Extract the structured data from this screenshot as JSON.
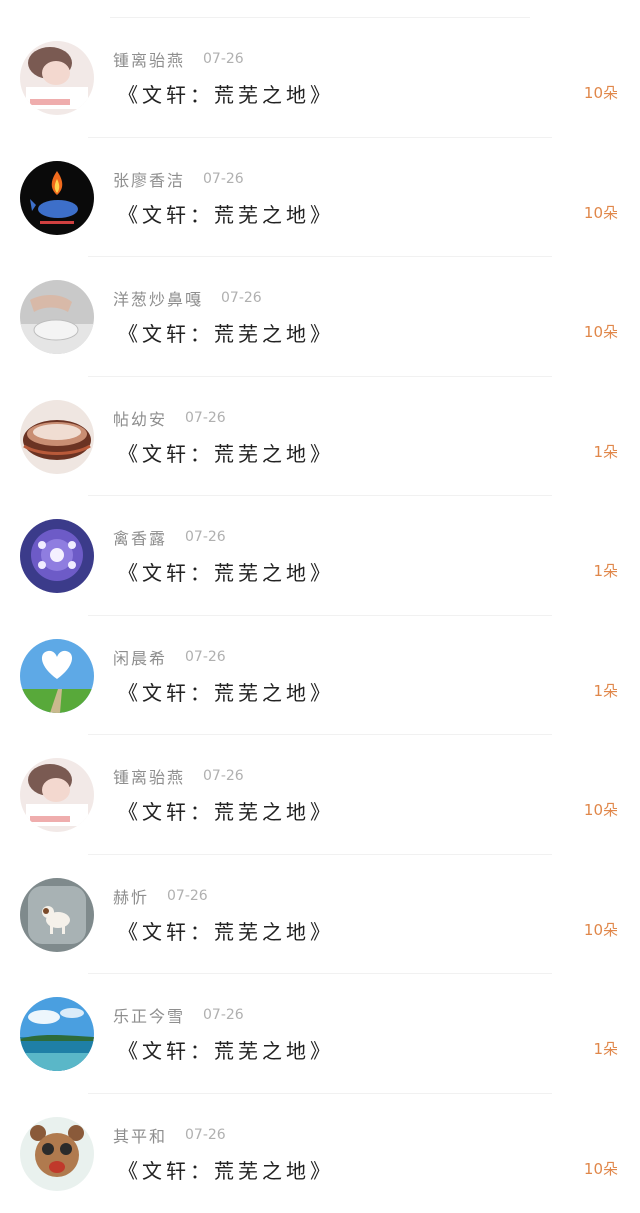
{
  "colors": {
    "accent": "#e0874a",
    "name_text": "#8e8e8e",
    "date_text": "#b0b0b0",
    "title_text": "#222222",
    "divider": "#f1f1f1"
  },
  "items": [
    {
      "avatar": "avatar-sleeping-girl",
      "name": "锺离骀燕",
      "date": "07-26",
      "title": "《文轩：荒芜之地》",
      "count": "10朵"
    },
    {
      "avatar": "avatar-fire-whale",
      "name": "张廖香洁",
      "date": "07-26",
      "title": "《文轩：荒芜之地》",
      "count": "10朵"
    },
    {
      "avatar": "avatar-hands-glass",
      "name": "洋葱炒鼻嘎",
      "date": "07-26",
      "title": "《文轩：荒芜之地》",
      "count": "10朵"
    },
    {
      "avatar": "avatar-bowl",
      "name": "帖幼安",
      "date": "07-26",
      "title": "《文轩：荒芜之地》",
      "count": "1朵"
    },
    {
      "avatar": "avatar-flower-cake",
      "name": "禽香露",
      "date": "07-26",
      "title": "《文轩：荒芜之地》",
      "count": "1朵"
    },
    {
      "avatar": "avatar-heart-sky",
      "name": "闲晨希",
      "date": "07-26",
      "title": "《文轩：荒芜之地》",
      "count": "1朵"
    },
    {
      "avatar": "avatar-sleeping-girl",
      "name": "锺离骀燕",
      "date": "07-26",
      "title": "《文轩：荒芜之地》",
      "count": "10朵"
    },
    {
      "avatar": "avatar-puppy",
      "name": "赫忻",
      "date": "07-26",
      "title": "《文轩：荒芜之地》",
      "count": "10朵"
    },
    {
      "avatar": "avatar-sea",
      "name": "乐正今雪",
      "date": "07-26",
      "title": "《文轩：荒芜之地》",
      "count": "1朵"
    },
    {
      "avatar": "avatar-bear",
      "name": "其平和",
      "date": "07-26",
      "title": "《文轩：荒芜之地》",
      "count": "10朵"
    }
  ]
}
